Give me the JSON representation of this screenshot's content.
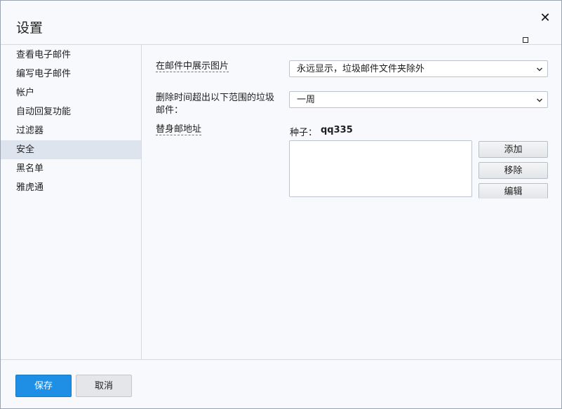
{
  "dialog": {
    "title": "设置",
    "close_glyph": "✕"
  },
  "sidebar": {
    "items": [
      {
        "label": "查看电子邮件"
      },
      {
        "label": "编写电子邮件"
      },
      {
        "label": "帐户"
      },
      {
        "label": "自动回复功能"
      },
      {
        "label": "过滤器"
      },
      {
        "label": "安全",
        "active": true
      },
      {
        "label": "黑名单"
      },
      {
        "label": "雅虎通"
      }
    ]
  },
  "security": {
    "show_images_label": "在邮件中展示图片",
    "show_images_value": "永远显示，垃圾邮件文件夹除外",
    "delete_spam_label_line1": "删除时间超出以下范围的垃圾",
    "delete_spam_label_line2": "邮件：",
    "delete_spam_value": "一周",
    "disposable_label": "替身邮地址",
    "seed_label": "种子：",
    "seed_value": "qq335",
    "add_button": "添加",
    "remove_button": "移除",
    "edit_button": "编辑"
  },
  "footer": {
    "save_button": "保存",
    "cancel_button": "取消"
  },
  "icons": {
    "chevron": "chevron-down-icon",
    "close": "close-icon"
  },
  "colors": {
    "primary": "#1f8fe6",
    "active_item_bg": "#dde4ee",
    "background": "#f7f9fc"
  }
}
